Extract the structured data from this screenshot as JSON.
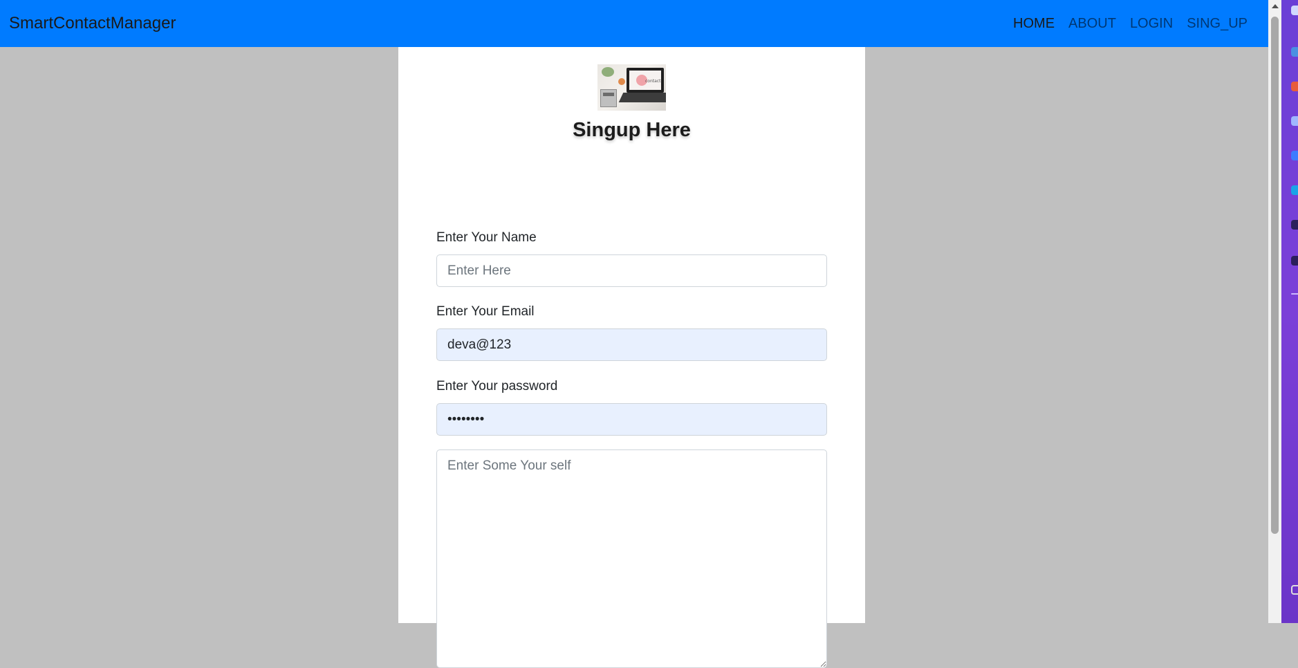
{
  "navbar": {
    "brand": "SmartContactManager",
    "links": [
      {
        "label": "HOME",
        "active": true
      },
      {
        "label": "ABOUT",
        "active": false
      },
      {
        "label": "LOGIN",
        "active": false
      },
      {
        "label": "SING_UP",
        "active": false
      }
    ],
    "bg_color": "#007bff"
  },
  "form": {
    "title": "Singup Here",
    "hero_screen_text": "contact",
    "name": {
      "label": "Enter Your Name",
      "placeholder": "Enter Here",
      "value": ""
    },
    "email": {
      "label": "Enter Your Email",
      "value": "deva@123"
    },
    "password": {
      "label": "Enter Your password",
      "value": "deva@123"
    },
    "about": {
      "placeholder": "Enter Some Your self"
    }
  }
}
